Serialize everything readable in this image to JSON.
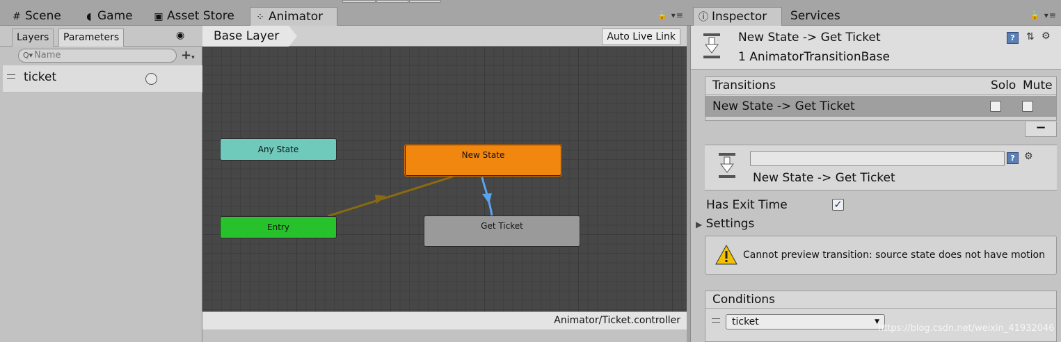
{
  "tabs": {
    "scene": "Scene",
    "game": "Game",
    "asset_store": "Asset Store",
    "animator": "Animator",
    "inspector": "Inspector",
    "services": "Services"
  },
  "icons": {
    "scene": "grid-icon",
    "game": "pacman-icon",
    "asset_store": "bag-icon",
    "animator": "animator-icon",
    "inspector": "info-icon",
    "lock": "lock-icon",
    "menu": "context-menu-icon",
    "eye": "eye-icon",
    "help": "help-book-icon",
    "settings": "gear-icon",
    "preset": "preset-icon",
    "warning": "warning-icon"
  },
  "parameters_panel": {
    "layers_tab": "Layers",
    "parameters_tab": "Parameters",
    "search_placeholder": "Name",
    "param_name": "ticket"
  },
  "graph": {
    "breadcrumb": "Base Layer",
    "auto_live_link": "Auto Live Link",
    "footer_path": "Animator/Ticket.controller",
    "nodes": {
      "any_state": "Any State",
      "entry": "Entry",
      "new_state": "New State",
      "get_ticket": "Get Ticket"
    },
    "colors": {
      "any_state": "#6fcabc",
      "entry": "#27c22b",
      "new_state": "#f2870f",
      "get_ticket": "#9a9a9a",
      "entry_transition": "#8a6a10",
      "selected_transition": "#5aa3f0"
    }
  },
  "inspector": {
    "title": "New State -> Get Ticket",
    "subtitle": "1 AnimatorTransitionBase",
    "transitions_header": "Transitions",
    "solo": "Solo",
    "mute": "Mute",
    "transition_row": "New State -> Get Ticket",
    "minus": "−",
    "transition_name": "New State -> Get Ticket",
    "has_exit_time_label": "Has Exit Time",
    "has_exit_time": true,
    "settings_label": "Settings",
    "warning": "Cannot preview transition: source state does not have motion",
    "conditions_header": "Conditions",
    "condition_param": "ticket"
  },
  "watermark": "https://blog.csdn.net/weixin_41932046"
}
